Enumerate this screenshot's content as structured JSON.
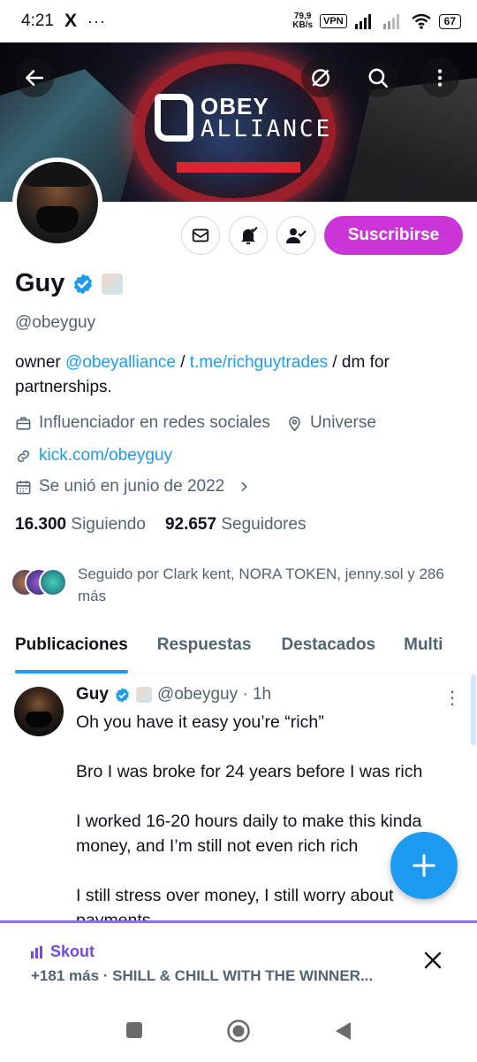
{
  "status_bar": {
    "time": "4:21",
    "app_icon": "X",
    "more": "···",
    "speed": "79,9",
    "speed_unit": "KB/s",
    "vpn": "VPN",
    "battery": "67"
  },
  "banner": {
    "brand_line1": "OBEY",
    "brand_line2": "ALLIANCE"
  },
  "profile": {
    "name": "Guy",
    "handle": "@obeyguy",
    "bio_prefix": "owner ",
    "bio_link1": "@obeyalliance",
    "bio_sep": " / ",
    "bio_link2": "t.me/richguytrades",
    "bio_suffix": " / dm for partnerships.",
    "category": "Influenciador en redes sociales",
    "location": "Universe",
    "website": "kick.com/obeyguy",
    "joined": "Se unió en junio de 2022",
    "following_count": "16.300",
    "following_label": "Siguiendo",
    "followers_count": "92.657",
    "followers_label": "Seguidores",
    "followed_by": "Seguido por Clark kent, NORA TOKEN, jenny.sol y 286 más",
    "subscribe_label": "Suscribirse"
  },
  "tabs": [
    {
      "label": "Publicaciones"
    },
    {
      "label": "Respuestas"
    },
    {
      "label": "Destacados"
    },
    {
      "label": "Multi"
    }
  ],
  "tweet": {
    "name": "Guy",
    "handle_time": "@obeyguy · 1h",
    "para1": "Oh you have it easy you’re “rich”",
    "para2": "Bro I was broke for 24 years before I was rich",
    "para3": "I worked 16-20 hours daily to make this kinda money, and I’m still not even rich rich",
    "para4": "I still stress over money, I still worry about payments"
  },
  "spaces": {
    "host": "Skout",
    "title": "+181 más · SHILL & CHILL WITH THE WINNER..."
  },
  "colors": {
    "accent": "#1d9bf0",
    "subscribe": "#c935d7",
    "spaces": "#6e4be6"
  }
}
